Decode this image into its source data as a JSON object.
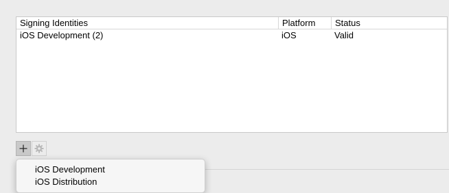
{
  "table": {
    "columns": [
      "Signing Identities",
      "Platform",
      "Status"
    ],
    "rows": [
      {
        "identity": "iOS Development (2)",
        "platform": "iOS",
        "status": "Valid"
      }
    ]
  },
  "toolbar": {
    "add_icon": "plus-icon",
    "action_icon": "gear-icon"
  },
  "menu": {
    "items": [
      "iOS Development",
      "iOS Distribution"
    ]
  }
}
